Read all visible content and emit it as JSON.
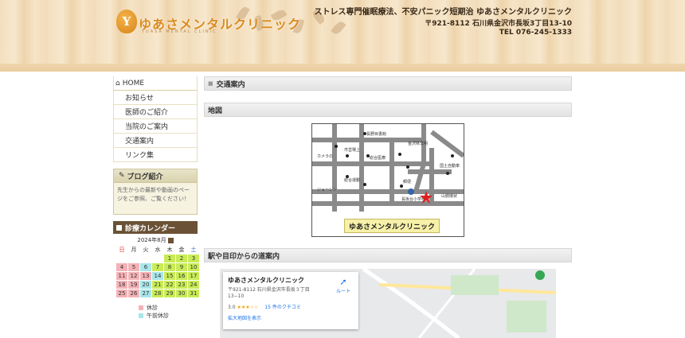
{
  "header": {
    "logo_letter": "Y",
    "site_title": "ゆあさメンタルクリニック",
    "site_subtitle": "YUASA MENTAL CLINIC",
    "tagline": "ストレス専門催眠療法、不安パニック短期治 ゆあさメンタルクリニック",
    "address": "〒921-8112 石川県金沢市長坂3丁目13-10",
    "tel": "TEL 076-245-1333"
  },
  "sidebar": {
    "nav": [
      {
        "label": "HOME"
      },
      {
        "label": "お知らせ"
      },
      {
        "label": "医師のご紹介"
      },
      {
        "label": "当院のご案内"
      },
      {
        "label": "交通案内"
      },
      {
        "label": "リンク集"
      }
    ],
    "blog": {
      "title": "ブログ紹介",
      "text": "先生からの最新や動画のページをご参照、ご覧ください！"
    },
    "calendar": {
      "title": "診療カレンダー",
      "month": "2024年8月",
      "weekdays": [
        "日",
        "月",
        "火",
        "水",
        "木",
        "金",
        "土"
      ],
      "rows": [
        [
          "",
          "",
          "",
          "",
          "1",
          "2",
          "3"
        ],
        [
          "4",
          "5",
          "6",
          "7",
          "8",
          "9",
          "10"
        ],
        [
          "11",
          "12",
          "13",
          "14",
          "15",
          "16",
          "17"
        ],
        [
          "18",
          "19",
          "20",
          "21",
          "22",
          "23",
          "24"
        ],
        [
          "25",
          "26",
          "27",
          "28",
          "29",
          "30",
          "31"
        ]
      ],
      "legend": [
        {
          "label": "休診",
          "color": "#f4b2b6"
        },
        {
          "label": "午前休診",
          "color": "#a8e6ea"
        }
      ]
    }
  },
  "main": {
    "page_title": "交通案内",
    "map_section": "地図",
    "map_banner": "ゆあさメンタルクリニック",
    "directions_section": "駅や目印からの道案内",
    "gmap": {
      "name": "ゆあさメンタルクリニック",
      "address": "〒921-8112 石川県金沢市長坂３丁目 13−10",
      "rating": "3.0",
      "stars": "★★★☆☆",
      "reviews": "15 件のクチコミ",
      "enlarge": "拡大地図を表示",
      "route": "ルート"
    }
  },
  "colors": {
    "accent": "#d98a1e",
    "calendar_head": "#6b5236",
    "closed": "#f4b2b6",
    "am_closed": "#a8e6ea",
    "open": "#c8ec55"
  }
}
